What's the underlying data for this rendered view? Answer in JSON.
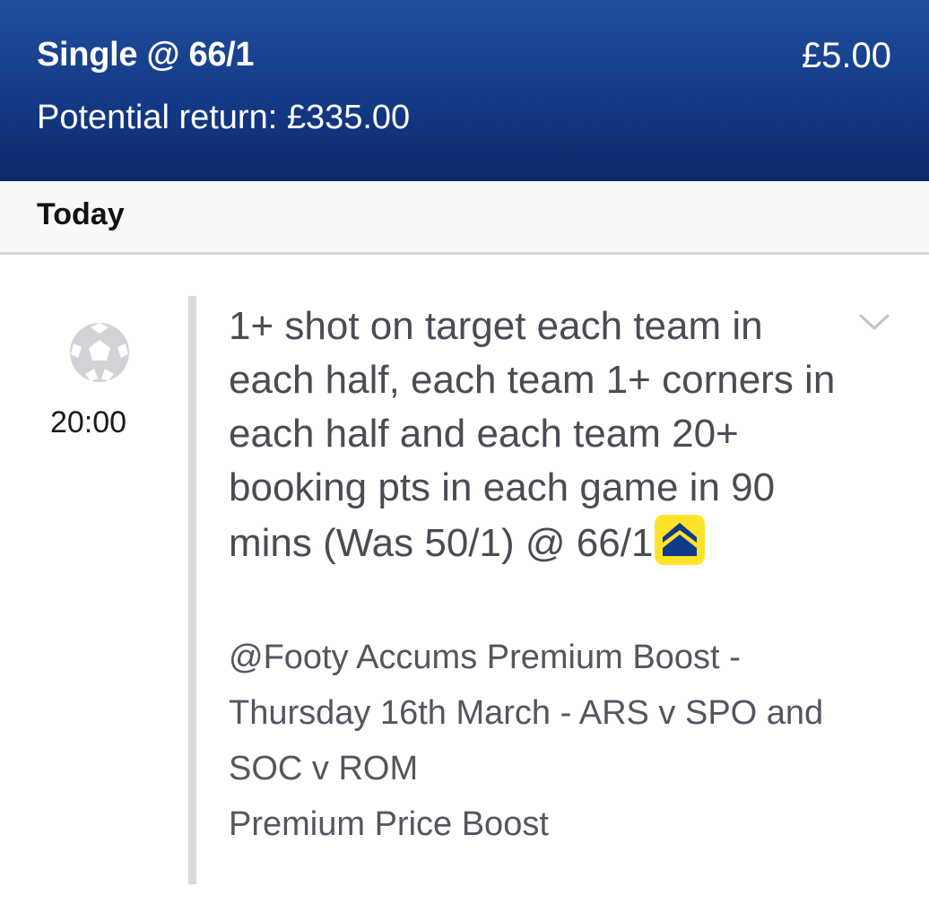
{
  "header": {
    "bet_type": "Single @ 66/1",
    "stake": "£5.00",
    "potential_return": "Potential return: £335.00",
    "colors": {
      "background": "#143a86",
      "text": "#ffffff"
    }
  },
  "day": {
    "label": "Today"
  },
  "selection": {
    "sport_icon": "football-icon",
    "time": "20:00",
    "title": "1+ shot on target each team in each half, each team 1+ corners in each half and each team 20+ booking pts in each game in 90 mins (Was 50/1) @ 66/1",
    "boost_icon": "price-boost-icon",
    "boost_badge_color": "#ffe22b",
    "expand_icon": "chevron-down-icon",
    "market": "@Footy Accums Premium Boost - Thursday 16th March - ARS v SPO and SOC v ROM",
    "boost_type": "Premium Price Boost"
  }
}
